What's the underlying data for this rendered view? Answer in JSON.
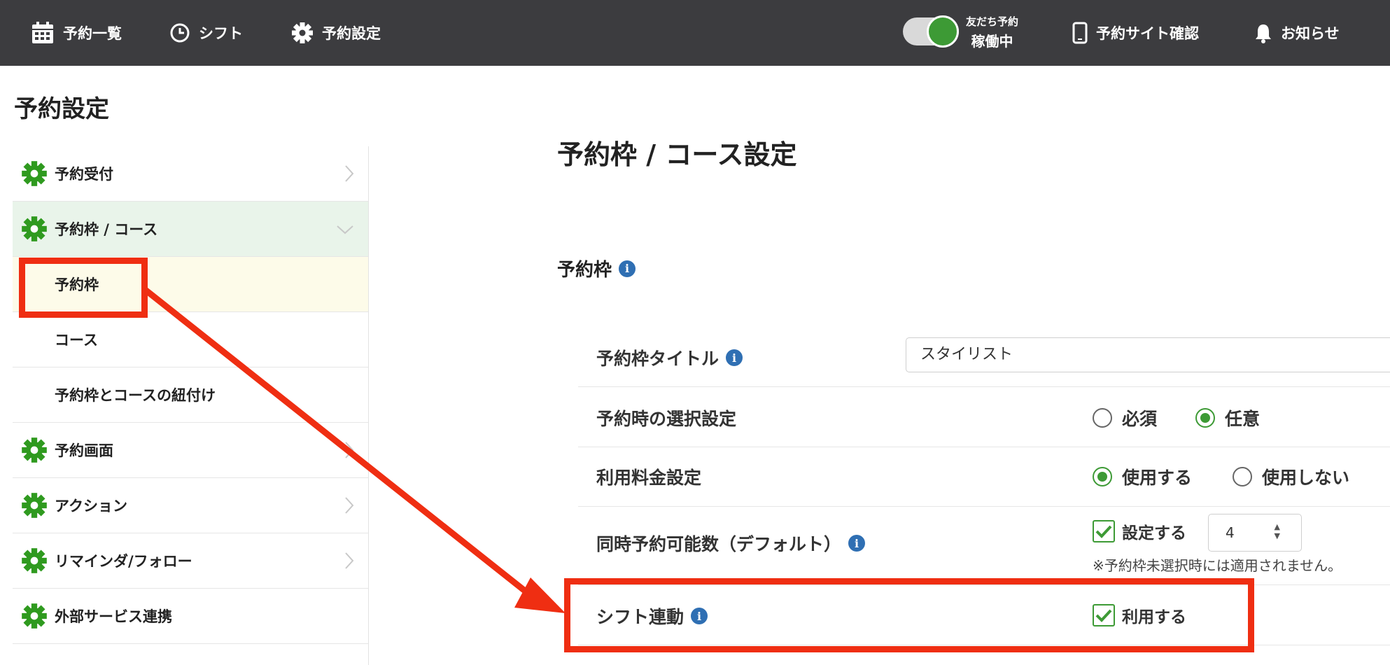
{
  "nav": {
    "items": [
      {
        "label": "予約一覧",
        "icon": "calendar-icon"
      },
      {
        "label": "シフト",
        "icon": "clock-icon"
      },
      {
        "label": "予約設定",
        "icon": "gear-icon"
      }
    ],
    "toggle": {
      "line1": "友だち予約",
      "line2": "稼働中",
      "state": "on"
    },
    "right": [
      {
        "label": "予約サイト確認",
        "icon": "phone-icon"
      },
      {
        "label": "お知らせ",
        "icon": "bell-icon"
      }
    ]
  },
  "page": {
    "title": "予約設定"
  },
  "sidebar": {
    "items": [
      {
        "label": "予約受付"
      },
      {
        "label": "予約枠 / コース"
      },
      {
        "label": "予約枠"
      },
      {
        "label": "コース"
      },
      {
        "label": "予約枠とコースの紐付け"
      },
      {
        "label": "予約画面"
      },
      {
        "label": "アクション"
      },
      {
        "label": "リマインダ/フォロー"
      },
      {
        "label": "外部サービス連携"
      }
    ]
  },
  "main": {
    "title": "予約枠 / コース設定",
    "section": "予約枠",
    "rows": {
      "title": {
        "label": "予約枠タイトル",
        "value": "スタイリスト"
      },
      "selection": {
        "label": "予約時の選択設定",
        "options": [
          "必須",
          "任意"
        ],
        "selected": "任意"
      },
      "fee": {
        "label": "利用料金設定",
        "options": [
          "使用する",
          "使用しない"
        ],
        "selected": "使用する"
      },
      "concurrent": {
        "label": "同時予約可能数（デフォルト）",
        "check_label": "設定する",
        "checked": true,
        "value": "4",
        "note": "※予約枠未選択時には適用されません。"
      },
      "shift": {
        "label": "シフト連動",
        "check_label": "利用する",
        "checked": true
      }
    }
  },
  "colors": {
    "accent": "#3d9a35",
    "topbar": "#3c3c3f",
    "annotation": "#ef2e12",
    "info": "#2f6fb3"
  }
}
